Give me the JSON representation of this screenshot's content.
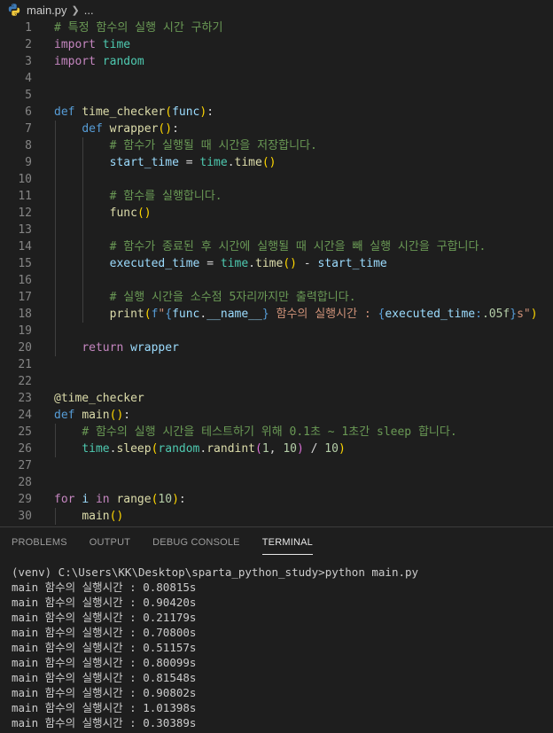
{
  "breadcrumb": {
    "file": "main.py",
    "more": "..."
  },
  "code_lines": [
    {
      "n": "1",
      "t": [
        [
          "cm",
          "# 특정 함수의 실행 시간 구하기"
        ]
      ]
    },
    {
      "n": "2",
      "t": [
        [
          "kw2",
          "import"
        ],
        [
          "",
          ""
        ],
        [
          "cls",
          " time"
        ]
      ]
    },
    {
      "n": "3",
      "t": [
        [
          "kw2",
          "import"
        ],
        [
          "cls",
          " random"
        ]
      ]
    },
    {
      "n": "4",
      "t": []
    },
    {
      "n": "5",
      "t": []
    },
    {
      "n": "6",
      "t": [
        [
          "kw",
          "def"
        ],
        [
          "",
          " "
        ],
        [
          "fn",
          "time_checker"
        ],
        [
          "br1",
          "("
        ],
        [
          "var",
          "func"
        ],
        [
          "br1",
          ")"
        ],
        [
          "",
          ":"
        ]
      ]
    },
    {
      "n": "7",
      "t": [
        [
          "",
          "    "
        ],
        [
          "kw",
          "def"
        ],
        [
          "",
          " "
        ],
        [
          "fn",
          "wrapper"
        ],
        [
          "br1",
          "()"
        ],
        [
          "",
          ":"
        ]
      ]
    },
    {
      "n": "8",
      "t": [
        [
          "",
          "        "
        ],
        [
          "cm",
          "# 함수가 실행될 때 시간을 저장합니다."
        ]
      ]
    },
    {
      "n": "9",
      "t": [
        [
          "",
          "        "
        ],
        [
          "var",
          "start_time"
        ],
        [
          "",
          " = "
        ],
        [
          "cls",
          "time"
        ],
        [
          "",
          "."
        ],
        [
          "fn",
          "time"
        ],
        [
          "br1",
          "()"
        ]
      ]
    },
    {
      "n": "10",
      "t": []
    },
    {
      "n": "11",
      "t": [
        [
          "",
          "        "
        ],
        [
          "cm",
          "# 함수를 실행합니다."
        ]
      ]
    },
    {
      "n": "12",
      "t": [
        [
          "",
          "        "
        ],
        [
          "fn",
          "func"
        ],
        [
          "br1",
          "()"
        ]
      ]
    },
    {
      "n": "13",
      "t": []
    },
    {
      "n": "14",
      "t": [
        [
          "",
          "        "
        ],
        [
          "cm",
          "# 함수가 종료된 후 시간에 실행될 때 시간을 빼 실행 시간을 구합니다."
        ]
      ]
    },
    {
      "n": "15",
      "t": [
        [
          "",
          "        "
        ],
        [
          "var",
          "executed_time"
        ],
        [
          "",
          " = "
        ],
        [
          "cls",
          "time"
        ],
        [
          "",
          "."
        ],
        [
          "fn",
          "time"
        ],
        [
          "br1",
          "()"
        ],
        [
          "",
          " - "
        ],
        [
          "var",
          "start_time"
        ]
      ]
    },
    {
      "n": "16",
      "t": []
    },
    {
      "n": "17",
      "t": [
        [
          "",
          "        "
        ],
        [
          "cm",
          "# 실행 시간을 소수점 5자리까지만 출력합니다."
        ]
      ]
    },
    {
      "n": "18",
      "t": [
        [
          "",
          "        "
        ],
        [
          "fn",
          "print"
        ],
        [
          "br1",
          "("
        ],
        [
          "kw",
          "f"
        ],
        [
          "str",
          "\""
        ],
        [
          "kw",
          "{"
        ],
        [
          "var",
          "func"
        ],
        [
          "",
          "."
        ],
        [
          "var",
          "__name__"
        ],
        [
          "kw",
          "}"
        ],
        [
          "str",
          " 함수의 실행시간 : "
        ],
        [
          "kw",
          "{"
        ],
        [
          "var",
          "executed_time"
        ],
        [
          "kw",
          ":"
        ],
        [
          "num",
          ".05f"
        ],
        [
          "kw",
          "}"
        ],
        [
          "str",
          "s\""
        ],
        [
          "br1",
          ")"
        ]
      ]
    },
    {
      "n": "19",
      "t": []
    },
    {
      "n": "20",
      "t": [
        [
          "",
          "    "
        ],
        [
          "kw2",
          "return"
        ],
        [
          "",
          " "
        ],
        [
          "var",
          "wrapper"
        ]
      ]
    },
    {
      "n": "21",
      "t": []
    },
    {
      "n": "22",
      "t": []
    },
    {
      "n": "23",
      "t": [
        [
          "fn",
          "@time_checker"
        ]
      ]
    },
    {
      "n": "24",
      "t": [
        [
          "kw",
          "def"
        ],
        [
          "",
          " "
        ],
        [
          "fn",
          "main"
        ],
        [
          "br1",
          "()"
        ],
        [
          "",
          ":"
        ]
      ]
    },
    {
      "n": "25",
      "t": [
        [
          "",
          "    "
        ],
        [
          "cm",
          "# 함수의 실행 시간을 테스트하기 위해 0.1초 ~ 1초간 sleep 합니다."
        ]
      ]
    },
    {
      "n": "26",
      "t": [
        [
          "",
          "    "
        ],
        [
          "cls",
          "time"
        ],
        [
          "",
          "."
        ],
        [
          "fn",
          "sleep"
        ],
        [
          "br1",
          "("
        ],
        [
          "cls",
          "random"
        ],
        [
          "",
          "."
        ],
        [
          "fn",
          "randint"
        ],
        [
          "br2",
          "("
        ],
        [
          "num",
          "1"
        ],
        [
          "",
          ", "
        ],
        [
          "num",
          "10"
        ],
        [
          "br2",
          ")"
        ],
        [
          "",
          " / "
        ],
        [
          "num",
          "10"
        ],
        [
          "br1",
          ")"
        ]
      ]
    },
    {
      "n": "27",
      "t": []
    },
    {
      "n": "28",
      "t": []
    },
    {
      "n": "29",
      "t": [
        [
          "kw2",
          "for"
        ],
        [
          "",
          " "
        ],
        [
          "var",
          "i"
        ],
        [
          "",
          " "
        ],
        [
          "kw2",
          "in"
        ],
        [
          "",
          " "
        ],
        [
          "fn",
          "range"
        ],
        [
          "br1",
          "("
        ],
        [
          "num",
          "10"
        ],
        [
          "br1",
          ")"
        ],
        [
          "",
          ":"
        ]
      ]
    },
    {
      "n": "30",
      "t": [
        [
          "",
          "    "
        ],
        [
          "fn",
          "main"
        ],
        [
          "br1",
          "()"
        ]
      ]
    }
  ],
  "panel": {
    "tabs": [
      "PROBLEMS",
      "OUTPUT",
      "DEBUG CONSOLE",
      "TERMINAL"
    ],
    "active_tab": "TERMINAL"
  },
  "terminal": {
    "lines": [
      "(venv) C:\\Users\\KK\\Desktop\\sparta_python_study>python main.py",
      "main 함수의 실행시간 : 0.80815s",
      "main 함수의 실행시간 : 0.90420s",
      "main 함수의 실행시간 : 0.21179s",
      "main 함수의 실행시간 : 0.70800s",
      "main 함수의 실행시간 : 0.51157s",
      "main 함수의 실행시간 : 0.80099s",
      "main 함수의 실행시간 : 0.81548s",
      "main 함수의 실행시간 : 0.90802s",
      "main 함수의 실행시간 : 1.01398s",
      "main 함수의 실행시간 : 0.30389s"
    ]
  },
  "icons": {
    "file_icon": "python-icon",
    "separator": "chevron-right-icon"
  }
}
